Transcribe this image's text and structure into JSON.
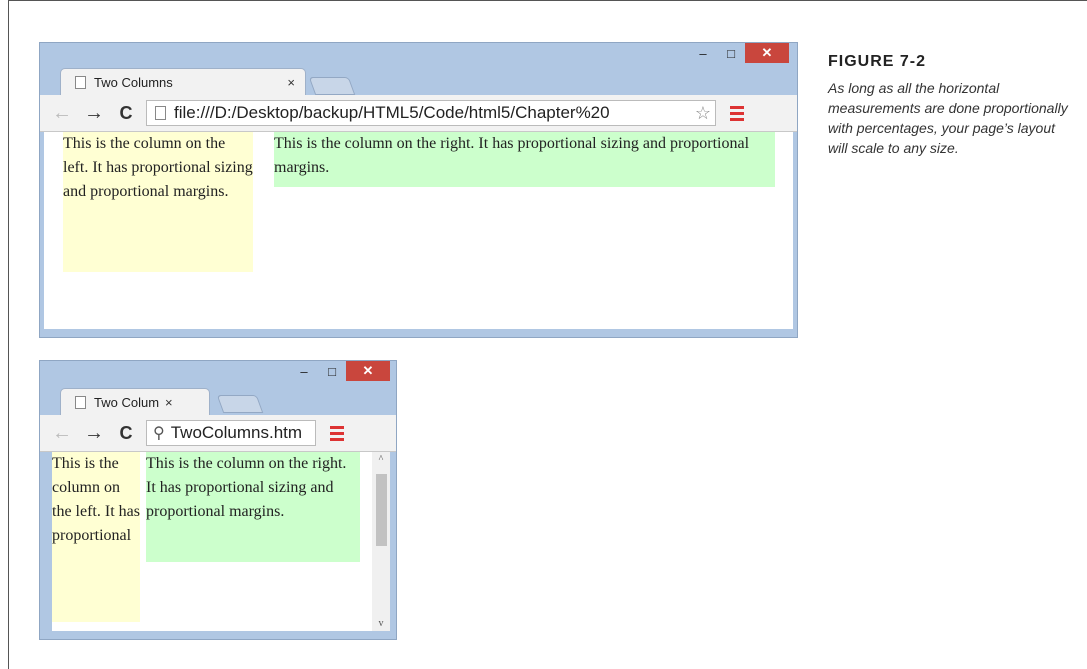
{
  "figure": {
    "label": "FIGURE 7-2",
    "caption": "As long as all the horizontal measurements are done proportionally with percentages, your page’s layout will scale to any size."
  },
  "large_window": {
    "tab_title": "Two Columns",
    "tab_close": "×",
    "url": "file:///D:/Desktop/backup/HTML5/Code/html5/Chapter%20",
    "left_column": "This is the column on the left. It has proportional sizing and proportional margins.",
    "right_column": "This is the column on the right. It has proportional sizing and proportional margins."
  },
  "small_window": {
    "tab_title": "Two Colum",
    "tab_close": "×",
    "url": "TwoColumns.htm",
    "left_column": "This is the column on the left. It has proportional",
    "right_column": "This is the column on the right. It has proportional sizing and proportional margins."
  },
  "icons": {
    "minimize": "–",
    "maximize": "□",
    "close": "✕",
    "back": "←",
    "forward": "→",
    "reload": "C",
    "star": "☆",
    "search": "⚲",
    "scroll_up": "^",
    "scroll_down": "v"
  },
  "colors": {
    "left_column_bg": "#ffffd3",
    "right_column_bg": "#ccffcc",
    "close_button": "#c9463d",
    "window_frame": "#b0c7e3"
  }
}
